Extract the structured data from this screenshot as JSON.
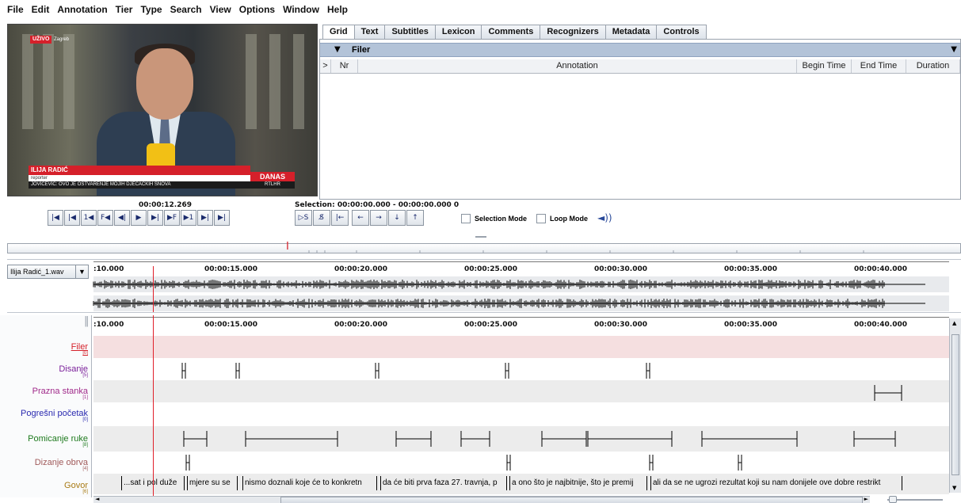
{
  "menu": [
    "File",
    "Edit",
    "Annotation",
    "Tier",
    "Type",
    "Search",
    "View",
    "Options",
    "Window",
    "Help"
  ],
  "video": {
    "live_badge": "UŽIVO",
    "live_location": "Zagreb",
    "name": "ILIJA RADIĆ",
    "role": "reporter",
    "headline": "JOVIČEVIĆ: OVO JE OSTVARENJE MOJIH DJEČAČKIH SNOVA",
    "show": "DANAS",
    "channel": "RTLHR"
  },
  "tabs": [
    "Grid",
    "Text",
    "Subtitles",
    "Lexicon",
    "Comments",
    "Recognizers",
    "Metadata",
    "Controls"
  ],
  "grid": {
    "tier": "Filer",
    "columns": [
      ">",
      "Nr",
      "Annotation",
      "Begin Time",
      "End Time",
      "Duration"
    ]
  },
  "player": {
    "current_time": "00:00:12.269",
    "selection": "Selection: 00:00:00.000 - 00:00:00.000  0",
    "buttons": [
      "|◀",
      "|◀",
      "1◀",
      "F◀",
      "◀|",
      "▶",
      "▶|",
      "▶F",
      "▶1",
      "▶|",
      "▶|"
    ],
    "select_buttons": [
      "▷S",
      "S̸",
      "|←"
    ],
    "arrow_buttons": [
      "←",
      "→",
      "↓",
      "↑"
    ],
    "selection_mode": "Selection Mode",
    "loop_mode": "Loop Mode"
  },
  "waveform": {
    "file": "Ilija Radić_1.wav",
    "ticks": [
      ":10.000",
      "00:00:15.000",
      "00:00:20.000",
      "00:00:25.000",
      "00:00:30.000",
      "00:00:35.000",
      "00:00:40.000"
    ]
  },
  "tiers": [
    {
      "name": "Filer",
      "count": "[0]",
      "color": "#d5202a"
    },
    {
      "name": "Disanje",
      "count": "[5]",
      "color": "#7a1f9a"
    },
    {
      "name": "Prazna stanka",
      "count": "[1]",
      "color": "#a02a8a"
    },
    {
      "name": "Pogrešni početak",
      "count": "[0]",
      "color": "#2a2ab0"
    },
    {
      "name": "Pomicanje ruke",
      "count": "[8]",
      "color": "#1e7a1e"
    },
    {
      "name": "Dizanje obrva",
      "count": "[4]",
      "color": "#a05a5a"
    },
    {
      "name": "Govor",
      "count": "[6]",
      "color": "#a87a14"
    }
  ],
  "govor_annotations": [
    "...sat i pol duže",
    "mjere su se",
    "nismo doznali koje će to konkretn",
    "da će biti prva faza 27. travnja, p",
    "a ono što je najbitnije, što je premij",
    "ali da se ne ugrozi rezultat koji su nam donijele ove dobre restrikt"
  ]
}
